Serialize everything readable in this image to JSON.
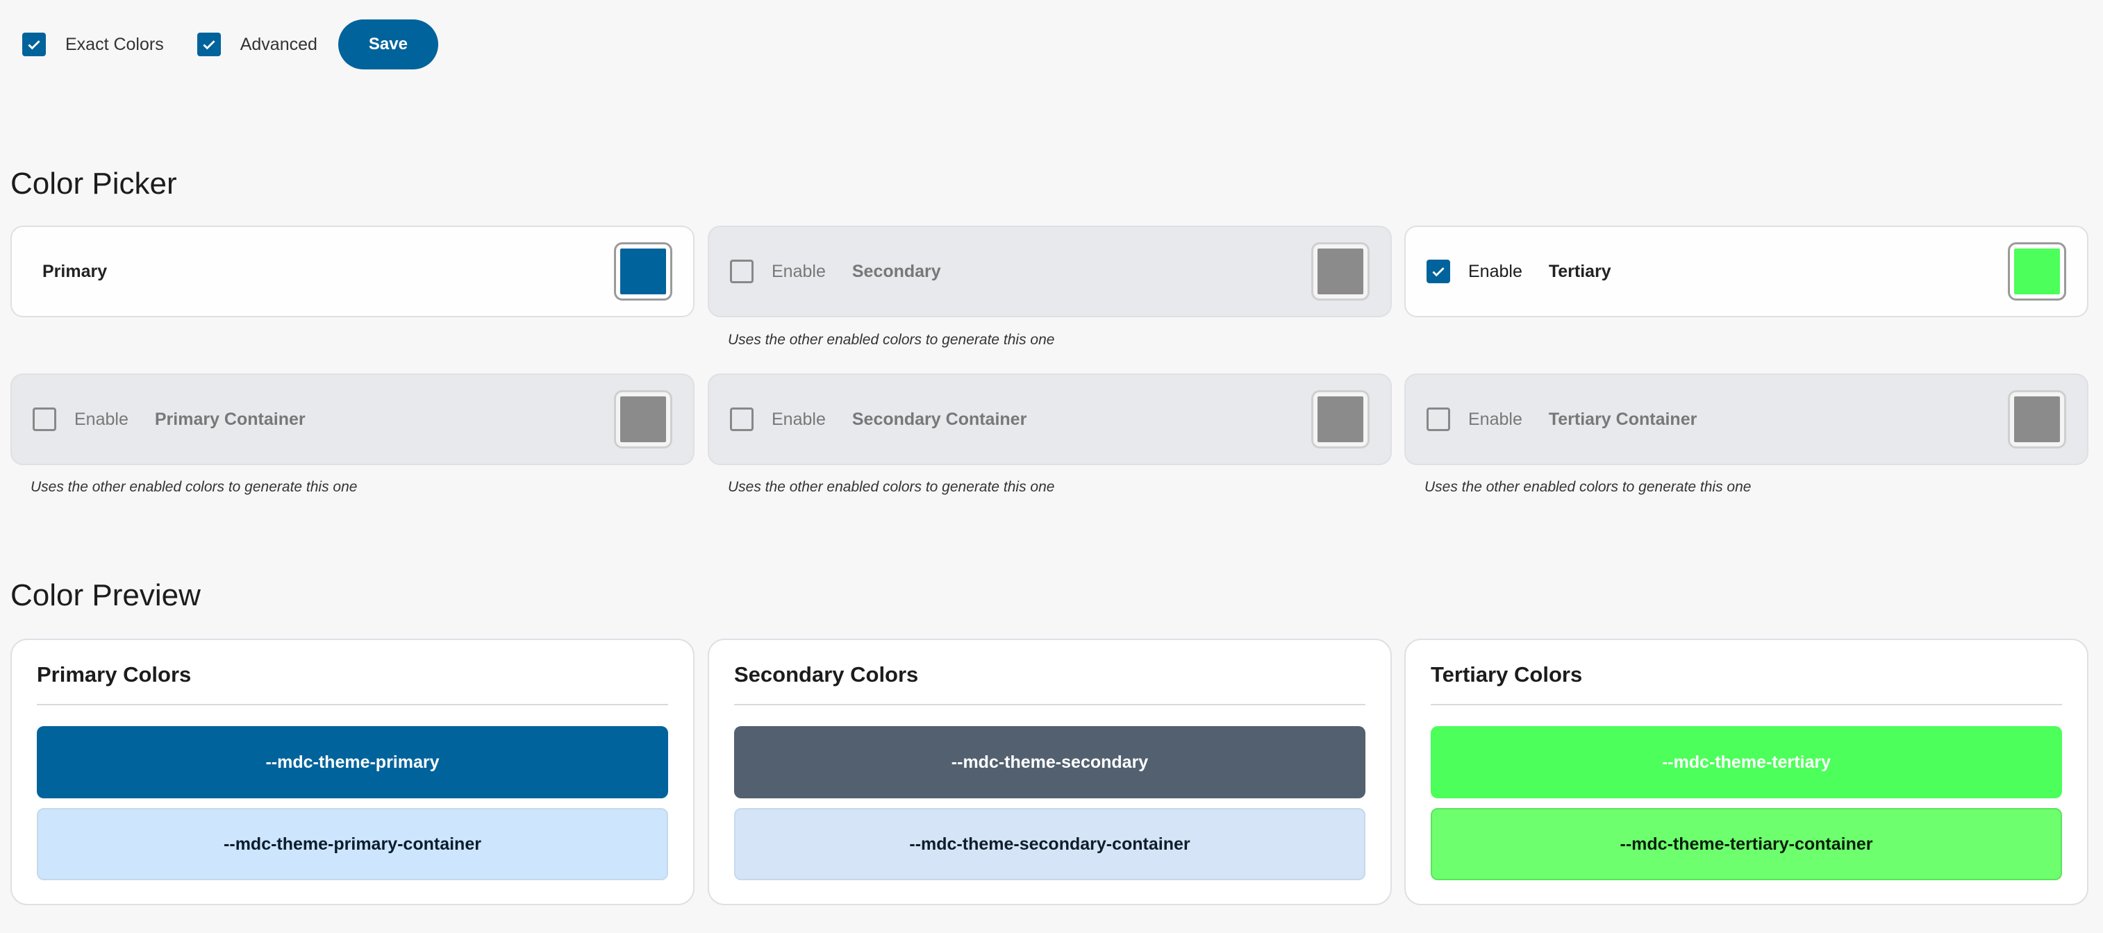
{
  "toolbar": {
    "exact_colors": {
      "label": "Exact Colors",
      "checked": true
    },
    "advanced": {
      "label": "Advanced",
      "checked": true
    },
    "save_label": "Save"
  },
  "color_picker": {
    "title": "Color Picker",
    "enable_label": "Enable",
    "hint": "Uses the other enabled colors to generate this one",
    "items": [
      {
        "name": "Primary",
        "has_toggle": false,
        "enabled": true,
        "color": "#00639b"
      },
      {
        "name": "Secondary",
        "has_toggle": true,
        "enabled": false,
        "color": "#8b8b8b"
      },
      {
        "name": "Tertiary",
        "has_toggle": true,
        "enabled": true,
        "color": "#4cff5a"
      },
      {
        "name": "Primary Container",
        "has_toggle": true,
        "enabled": false,
        "color": "#8b8b8b"
      },
      {
        "name": "Secondary Container",
        "has_toggle": true,
        "enabled": false,
        "color": "#8b8b8b"
      },
      {
        "name": "Tertiary Container",
        "has_toggle": true,
        "enabled": false,
        "color": "#8b8b8b"
      }
    ]
  },
  "color_preview": {
    "title": "Color Preview",
    "cards": [
      {
        "title": "Primary Colors",
        "main": {
          "label": "--mdc-theme-primary",
          "bg": "#00639b",
          "fg": "#ffffff"
        },
        "container": {
          "label": "--mdc-theme-primary-container",
          "bg": "#cde5fd",
          "fg": "#0b1d2c"
        }
      },
      {
        "title": "Secondary Colors",
        "main": {
          "label": "--mdc-theme-secondary",
          "bg": "#52606f",
          "fg": "#ffffff"
        },
        "container": {
          "label": "--mdc-theme-secondary-container",
          "bg": "#d5e4f6",
          "fg": "#101d2a"
        }
      },
      {
        "title": "Tertiary Colors",
        "main": {
          "label": "--mdc-theme-tertiary",
          "bg": "#4cff5a",
          "fg": "#ffffff"
        },
        "container": {
          "label": "--mdc-theme-tertiary-container",
          "bg": "#6dff6e",
          "fg": "#0a1f0b"
        }
      }
    ]
  }
}
